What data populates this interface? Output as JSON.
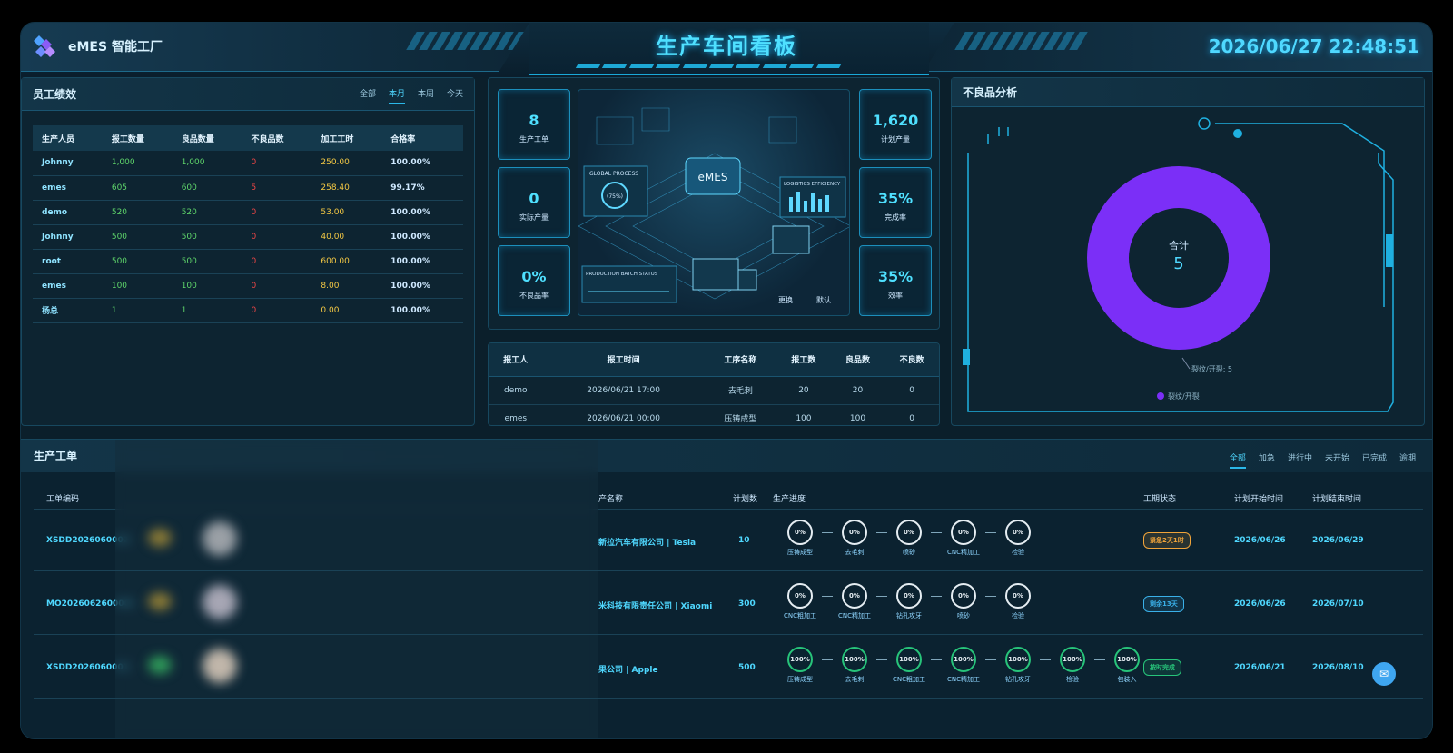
{
  "header": {
    "brand": "eMES 智能工厂",
    "title": "生产车间看板",
    "datetime": "2026/06/27 22:48:51"
  },
  "employee": {
    "title": "员工绩效",
    "tabs": [
      "全部",
      "本月",
      "本周",
      "今天"
    ],
    "active_tab": "本月",
    "columns": [
      "生产人员",
      "报工数量",
      "良品数量",
      "不良品数",
      "加工工时",
      "合格率"
    ],
    "rows": [
      [
        "Johnny",
        "1,000",
        "1,000",
        "0",
        "250.00",
        "100.00%"
      ],
      [
        "emes",
        "605",
        "600",
        "5",
        "258.40",
        "99.17%"
      ],
      [
        "demo",
        "520",
        "520",
        "0",
        "53.00",
        "100.00%"
      ],
      [
        "Johnny",
        "500",
        "500",
        "0",
        "40.00",
        "100.00%"
      ],
      [
        "root",
        "500",
        "500",
        "0",
        "600.00",
        "100.00%"
      ],
      [
        "emes",
        "100",
        "100",
        "0",
        "8.00",
        "100.00%"
      ],
      [
        "杨总",
        "1",
        "1",
        "0",
        "0.00",
        "100.00%"
      ]
    ]
  },
  "kpis": {
    "left": [
      {
        "value": "8",
        "label": "生产工单"
      },
      {
        "value": "0",
        "label": "实际产量"
      },
      {
        "value": "0%",
        "label": "不良品率"
      }
    ],
    "right": [
      {
        "value": "1,620",
        "label": "计划产量"
      },
      {
        "value": "35%",
        "label": "完成率"
      },
      {
        "value": "35%",
        "label": "效率"
      }
    ]
  },
  "illustration": {
    "center_label": "eMES",
    "global_process": "GLOBAL PROCESS",
    "global_pct": "(75%)",
    "logistics": "LOGISTICS EFFICIENCY",
    "batch": "PRODUCTION BATCH STATUS",
    "btn_change": "更换",
    "btn_default": "默认"
  },
  "reports": {
    "columns": [
      "报工人",
      "报工时间",
      "工序名称",
      "报工数",
      "良品数",
      "不良数"
    ],
    "rows": [
      [
        "demo",
        "2026/06/21 17:00",
        "去毛刺",
        "20",
        "20",
        "0"
      ],
      [
        "emes",
        "2026/06/21 00:00",
        "压铸成型",
        "100",
        "100",
        "0"
      ]
    ]
  },
  "defects": {
    "title": "不良品分析",
    "total_label": "合计",
    "total_value": "5",
    "slice_label": "裂纹/开裂: 5",
    "legend": "裂纹/开裂",
    "color": "#7b2ff7"
  },
  "chart_data": {
    "type": "pie",
    "title": "不良品分析",
    "categories": [
      "裂纹/开裂"
    ],
    "values": [
      5
    ],
    "colors": [
      "#7b2ff7"
    ],
    "legend": "bottom"
  },
  "orders": {
    "title": "生产工单",
    "tabs": [
      "全部",
      "加急",
      "进行中",
      "未开始",
      "已完成",
      "逾期"
    ],
    "active_tab": "全部",
    "columns": {
      "code": "工单编码",
      "product": "产名称",
      "qty": "计划数",
      "progress": "生产进度",
      "status": "工期状态",
      "start": "计划开始时间",
      "end": "计划结束时间"
    },
    "rows": [
      {
        "code": "XSDD2026060002-",
        "customer": "新拉汽车有限公司 | Tesla",
        "qty": "10",
        "steps": [
          [
            "0%",
            "压铸成型"
          ],
          [
            "0%",
            "去毛刺"
          ],
          [
            "0%",
            "喷砂"
          ],
          [
            "0%",
            "CNC精加工"
          ],
          [
            "0%",
            "检验"
          ]
        ],
        "status": "紧急2天1时",
        "status_color": "#f0a43a",
        "start": "2026/06/26",
        "end": "2026/06/29"
      },
      {
        "code": "MO2026062600001",
        "customer": "米科技有限责任公司 | Xiaomi",
        "qty": "300",
        "steps": [
          [
            "0%",
            "CNC粗加工"
          ],
          [
            "0%",
            "CNC精加工"
          ],
          [
            "0%",
            "钻孔攻牙"
          ],
          [
            "0%",
            "喷砂"
          ],
          [
            "0%",
            "检验"
          ]
        ],
        "status": "剩余13天",
        "status_color": "#3ab0e8",
        "start": "2026/06/26",
        "end": "2026/07/10"
      },
      {
        "code": "XSDD2026060001-",
        "customer": "果公司 | Apple",
        "qty": "500",
        "steps": [
          [
            "100%",
            "压铸成型"
          ],
          [
            "100%",
            "去毛刺"
          ],
          [
            "100%",
            "CNC粗加工"
          ],
          [
            "100%",
            "CNC精加工"
          ],
          [
            "100%",
            "钻孔攻牙"
          ],
          [
            "100%",
            "检验"
          ],
          [
            "100%",
            "包装入"
          ]
        ],
        "status": "按时完成",
        "status_color": "#27c47a",
        "start": "2026/06/21",
        "end": "2026/08/10"
      }
    ]
  }
}
